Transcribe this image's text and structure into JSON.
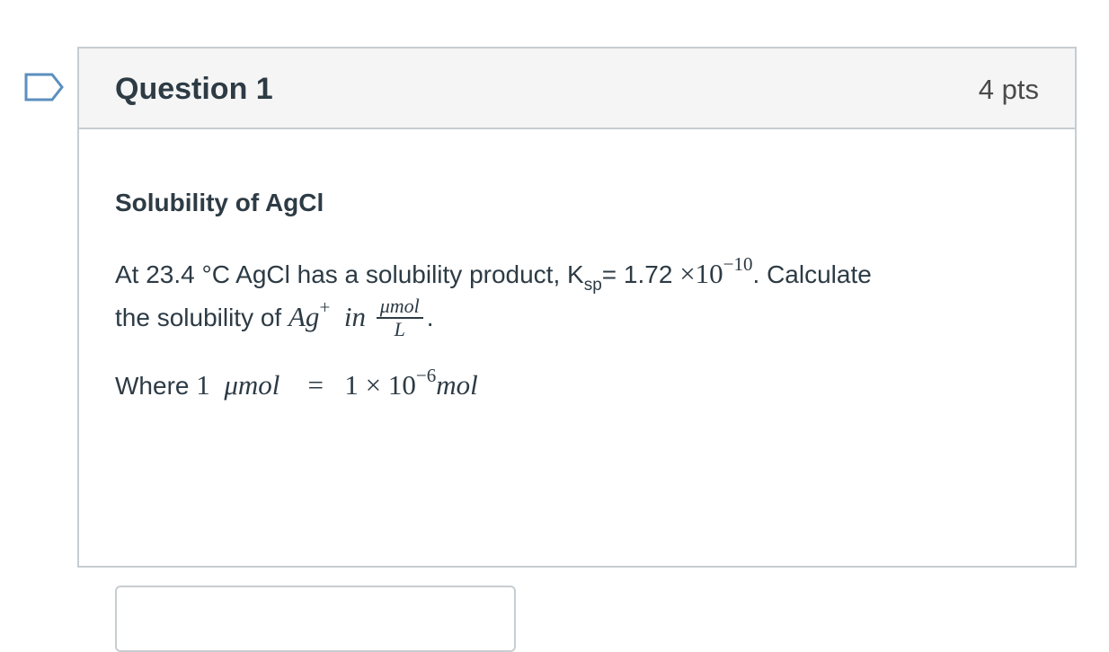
{
  "flag_icon": "bookmark-flag-outline-icon",
  "question": {
    "title": "Question 1",
    "points": "4 pts",
    "heading": "Solubility of AgCl",
    "line1": {
      "prefix": "At 23.4 °C AgCl has a solubility product, K",
      "ksp_sub": "sp",
      "eq": "= 1.72 ",
      "times": "×",
      "ten": "10",
      "exp": "−10",
      "suffix": ".  Calculate"
    },
    "line2": {
      "prefix": "the solubility of ",
      "ag": "Ag",
      "ag_sup": "+",
      "in_word": "in",
      "frac_num": "μmol",
      "frac_den": "L",
      "suffix": "."
    },
    "line3": {
      "prefix": "Where ",
      "one": "1",
      "umol": "μmol",
      "equals": "=",
      "one_b": "1",
      "times": "×",
      "ten": "10",
      "exp": "−6",
      "mol": "mol"
    }
  },
  "answer": {
    "value": "",
    "placeholder": ""
  },
  "colors": {
    "text": "#2d3b45",
    "header_bg": "#f5f5f5",
    "border": "#c7cdd1",
    "flag_stroke": "#5b8fbf"
  }
}
